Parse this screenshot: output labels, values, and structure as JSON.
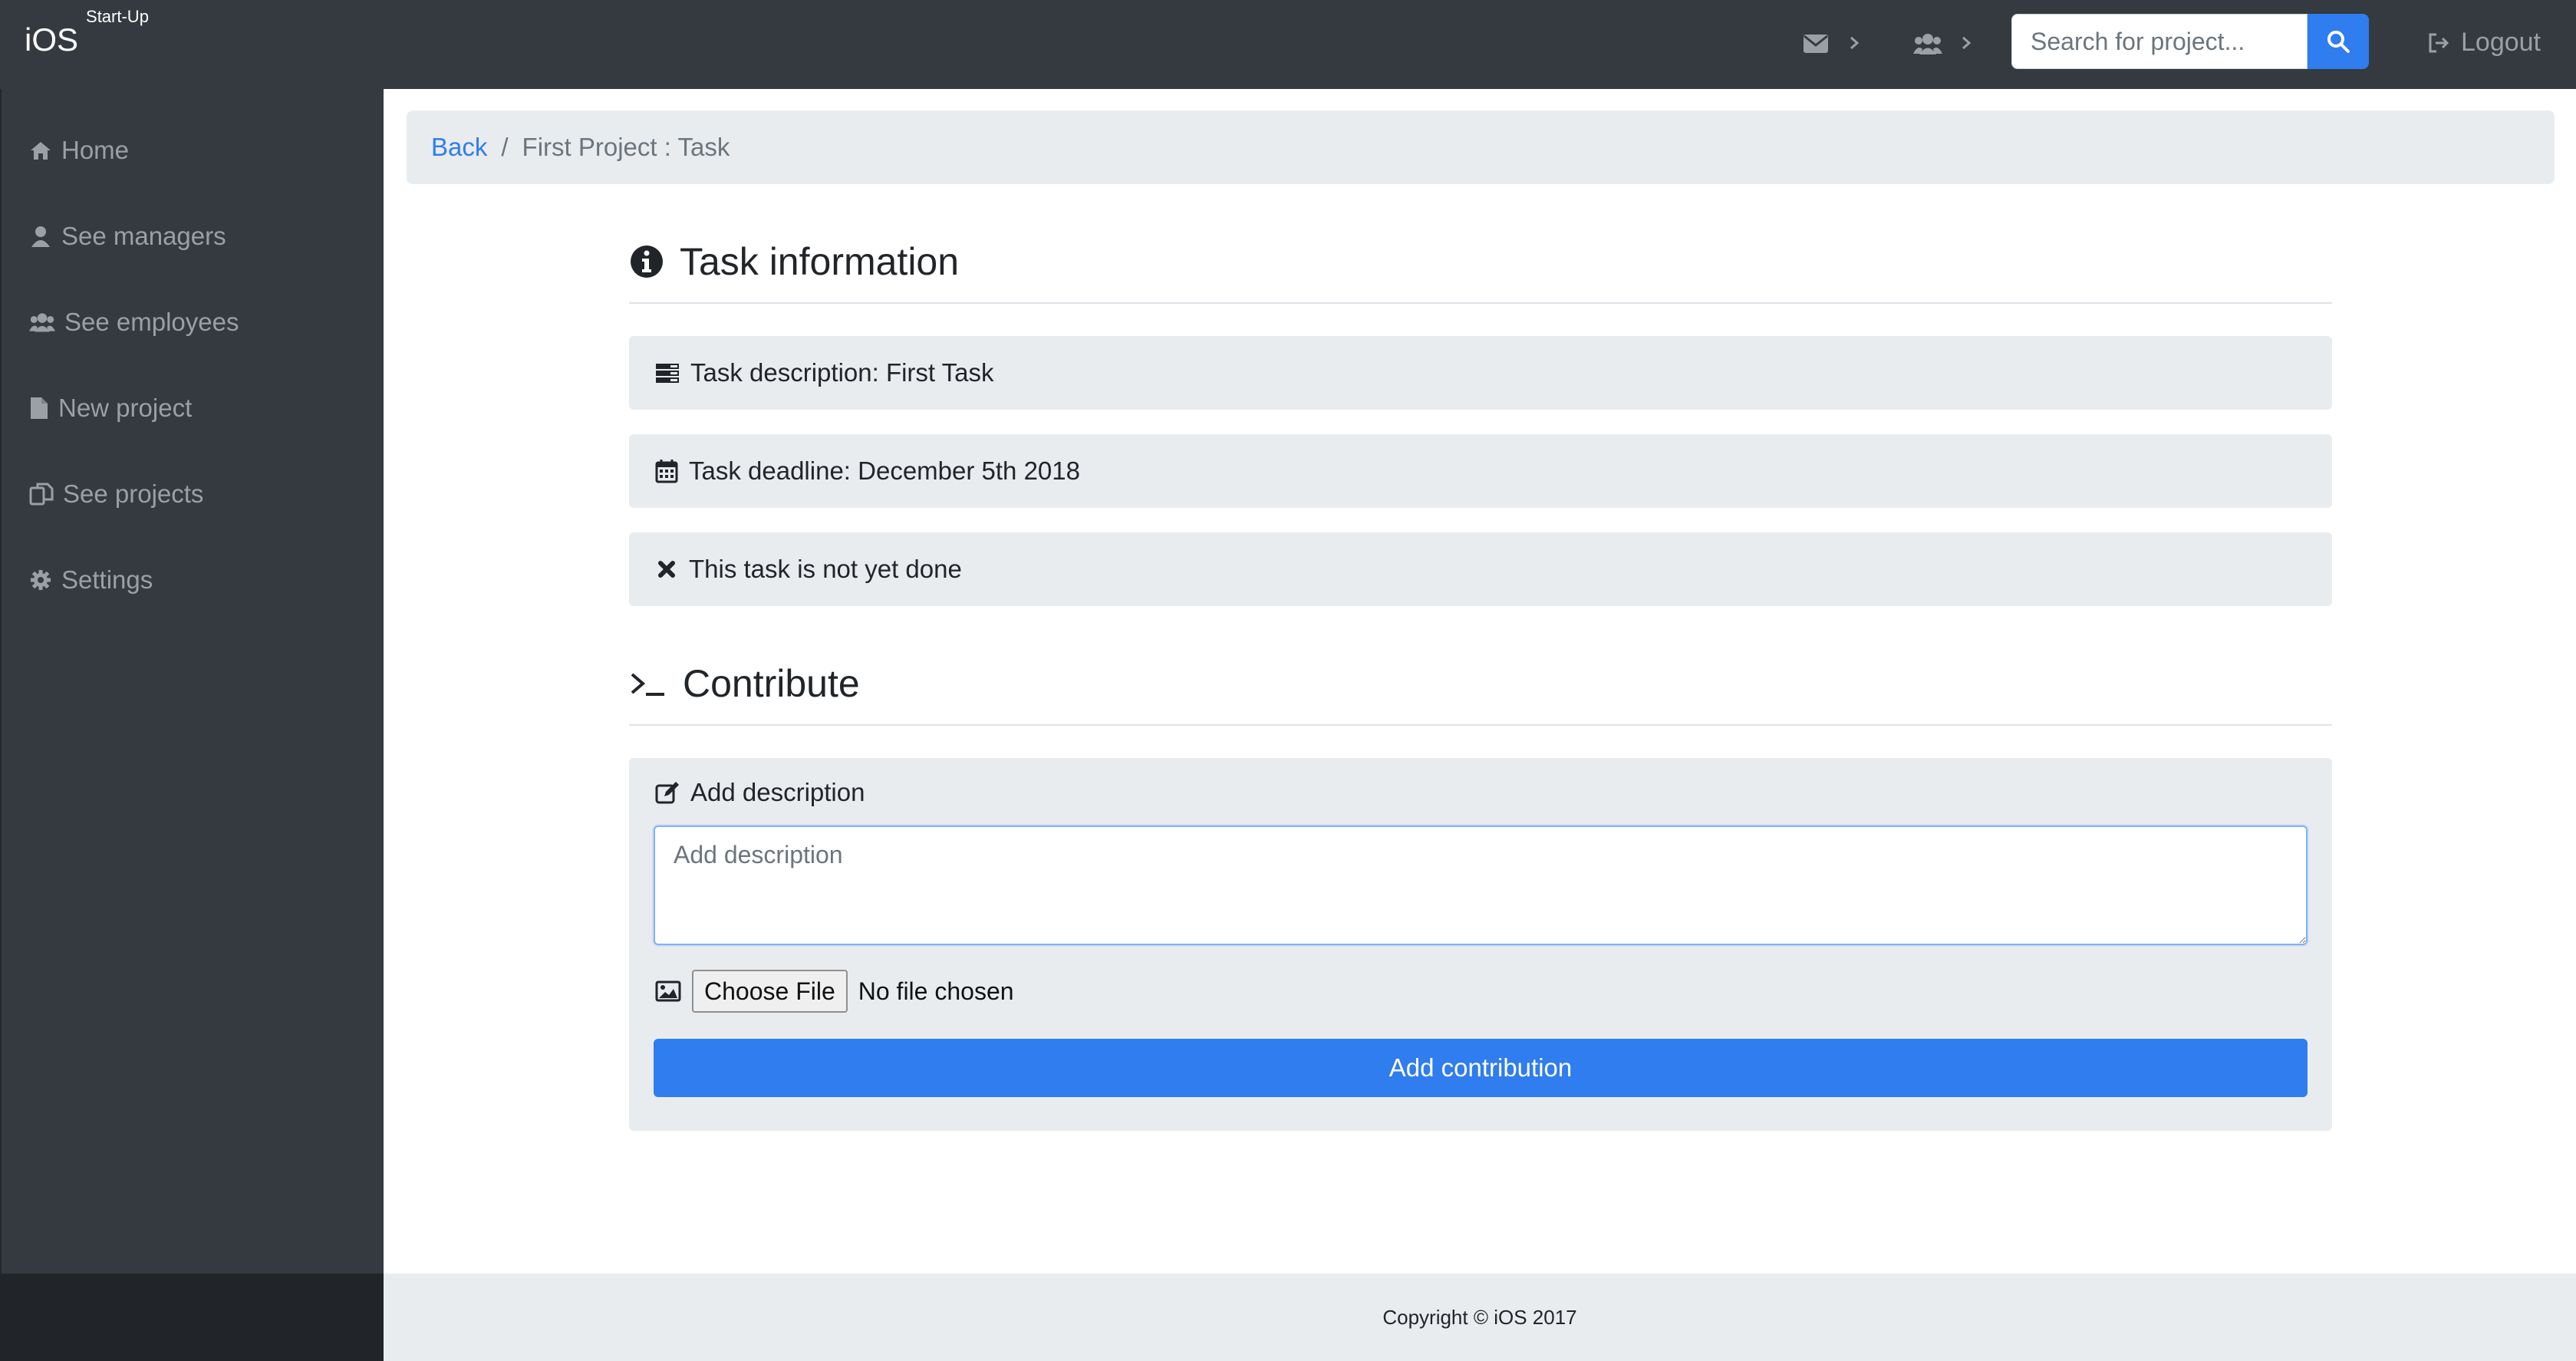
{
  "brand": {
    "name": "iOS",
    "tagline": "Start-Up"
  },
  "navbar": {
    "icons": [
      "envelope-icon",
      "users-icon"
    ],
    "search_placeholder": "Search for project...",
    "logout_label": "Logout"
  },
  "sidebar": {
    "items": [
      {
        "label": "Home",
        "icon": "home-icon"
      },
      {
        "label": "See managers",
        "icon": "user-icon"
      },
      {
        "label": "See employees",
        "icon": "users-icon"
      },
      {
        "label": "New project",
        "icon": "file-icon"
      },
      {
        "label": "See projects",
        "icon": "copy-icon"
      },
      {
        "label": "Settings",
        "icon": "gear-icon"
      }
    ]
  },
  "breadcrumb": {
    "back_label": "Back",
    "separator": "/",
    "current": "First Project : Task"
  },
  "task_info": {
    "heading": "Task information",
    "description": "Task description: First Task",
    "deadline": "Task deadline: December 5th 2018",
    "status": "This task is not yet done"
  },
  "contribute": {
    "heading": "Contribute",
    "description_label": "Add description",
    "description_placeholder": "Add description",
    "choose_file_label": "Choose File",
    "file_status": "No file chosen",
    "submit_label": "Add contribution"
  },
  "footer": {
    "copyright": "Copyright © iOS 2017"
  },
  "colors": {
    "navbar": "#343a40",
    "accent": "#2f7dee",
    "panel": "#e9ecef"
  }
}
